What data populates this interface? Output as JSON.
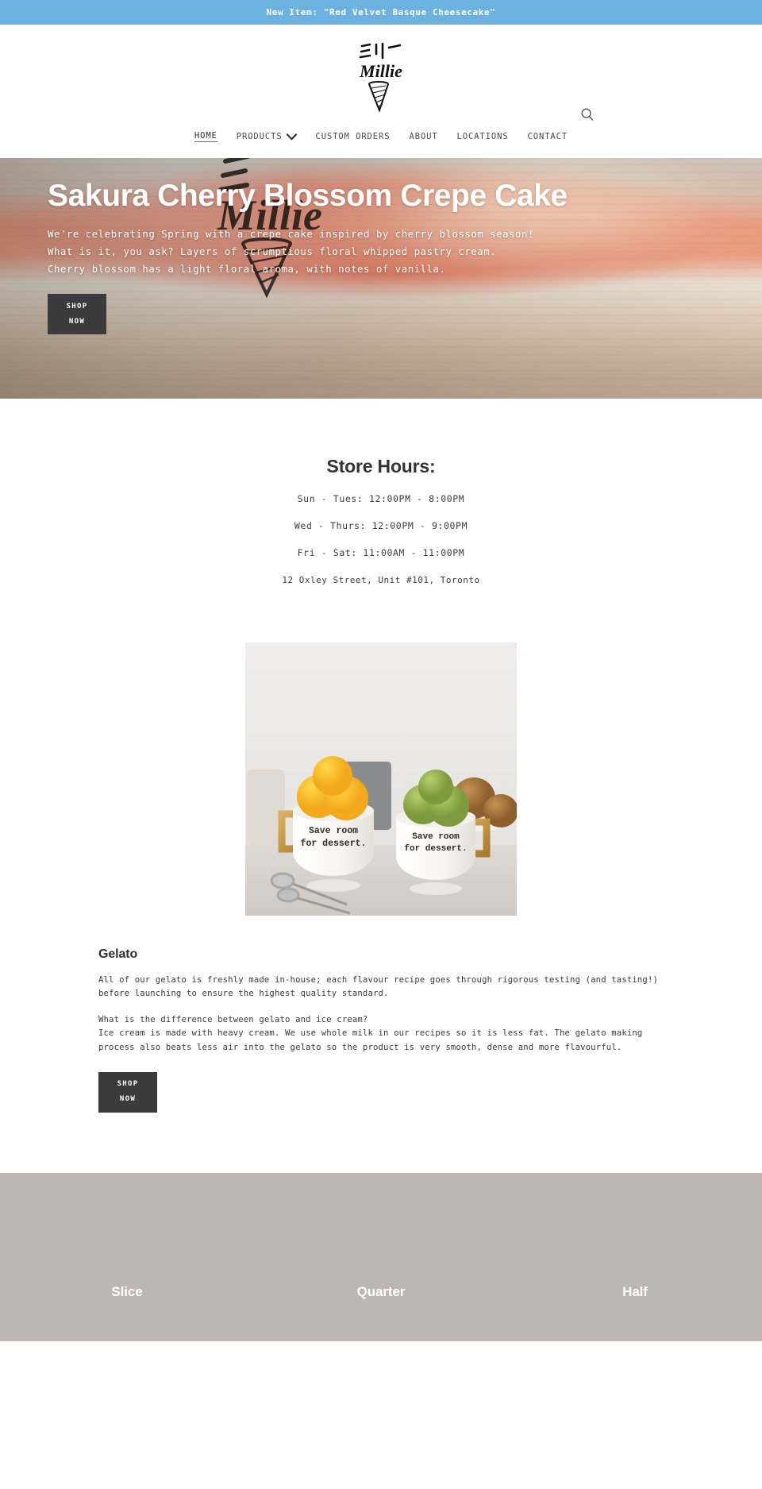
{
  "announcement": {
    "text": "New Item: \"Red Velvet Basque Cheesecake\"",
    "background": "#6cb2e0",
    "text_color": "#ffffff"
  },
  "header": {
    "logo_text": "Millie",
    "logo_kana": "ミリー",
    "logo_alt": "Millie ice cream cone logo",
    "search_icon": "search-icon"
  },
  "nav": {
    "items": [
      {
        "label": "HOME",
        "active": true,
        "has_dropdown": false
      },
      {
        "label": "PRODUCTS",
        "active": false,
        "has_dropdown": true
      },
      {
        "label": "CUSTOM ORDERS",
        "active": false,
        "has_dropdown": false
      },
      {
        "label": "ABOUT",
        "active": false,
        "has_dropdown": false
      },
      {
        "label": "LOCATIONS",
        "active": false,
        "has_dropdown": false
      },
      {
        "label": "CONTACT",
        "active": false,
        "has_dropdown": false
      }
    ]
  },
  "hero": {
    "title": "Sakura Cherry Blossom Crepe Cake",
    "paragraph_lines": [
      "We're celebrating Spring with a crepe cake inspired by cherry blossom season!",
      "What is it, you ask? Layers of scrumptious floral whipped pastry cream.",
      "Cherry blossom has a light floral aroma, with notes of vanilla."
    ],
    "cta_line1": "SHOP",
    "cta_line2": "NOW",
    "image_alt": "Pink sakura crepe cake slice",
    "cta_background": "#3b3b3b"
  },
  "store_hours": {
    "title": "Store Hours:",
    "lines": [
      "Sun - Tues: 12:00PM - 8:00PM",
      "Wed - Thurs: 12:00PM - 9:00PM",
      "Fri - Sat: 11:00AM - 11:00PM"
    ],
    "address": "12 Oxley Street, Unit #101, Toronto"
  },
  "gelato": {
    "image_alt": "Two mugs of mango and pistachio gelato",
    "mug_text_line1": "Save room",
    "mug_text_line2": "for dessert.",
    "heading": "Gelato",
    "paragraph1": "All of our gelato is freshly made in-house; each flavour recipe goes through rigorous testing (and tasting!) before launching to ensure the highest quality standard.",
    "question": "What is the difference between gelato and ice cream?",
    "paragraph2": "Ice cream is made with heavy cream. We use whole milk in our recipes so it is less fat. The gelato making process also beats less air into the gelato so the product is very smooth, dense and more flavourful.",
    "cta_line1": "SHOP",
    "cta_line2": "NOW"
  },
  "sizes": {
    "background": "#bdb6b4",
    "columns": [
      {
        "label": "Slice"
      },
      {
        "label": "Quarter"
      },
      {
        "label": "Half"
      }
    ]
  }
}
